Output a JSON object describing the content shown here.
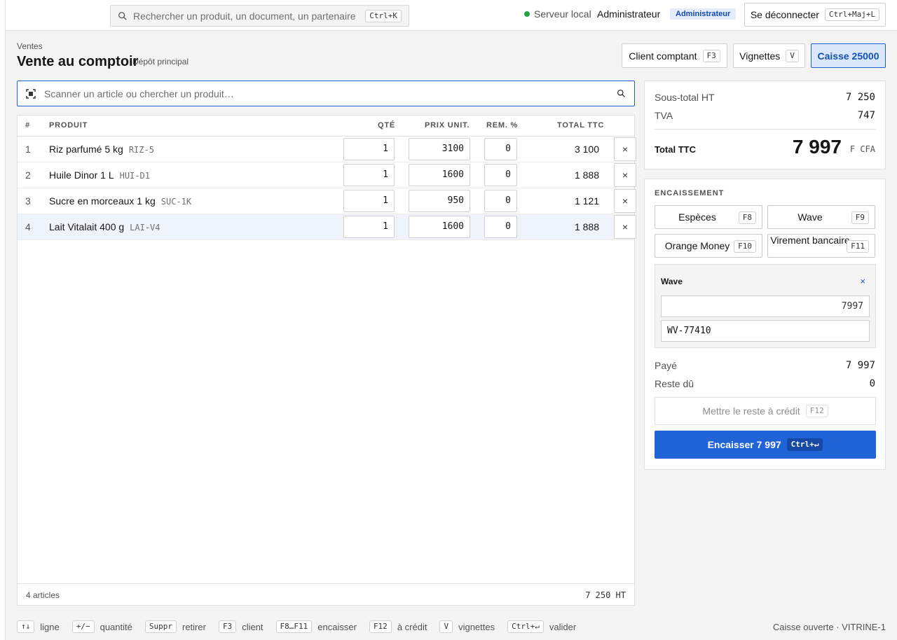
{
  "topbar": {
    "search_placeholder": "Rechercher un produit, un document, un partenaire",
    "search_shortcut": "Ctrl+K",
    "server_status": "Serveur local",
    "server_status_color": "#24a148",
    "user_name": "Administrateur",
    "role_badge": "Administrateur",
    "logout_label": "Se déconnecter",
    "logout_shortcut": "Ctrl+Maj+L"
  },
  "header": {
    "breadcrumb": "Ventes",
    "title": "Vente au comptoir",
    "depot": "Dépôt principal",
    "client_label": "Client comptant",
    "client_shortcut": "F3",
    "vignettes_label": "Vignettes",
    "vignettes_shortcut": "V",
    "caisse_label": "Caisse 25000"
  },
  "scan": {
    "placeholder": "Scanner un article ou chercher un produit…"
  },
  "table": {
    "columns": {
      "num": "#",
      "product": "PRODUIT",
      "qty": "QTÉ",
      "unit_price": "PRIX UNIT.",
      "discount": "REM. %",
      "total": "TOTAL TTC"
    },
    "rows": [
      {
        "num": "1",
        "name": "Riz parfumé 5 kg",
        "code": "RIZ-5",
        "qty": "1",
        "price": "3100",
        "discount": "0",
        "total": "3 100"
      },
      {
        "num": "2",
        "name": "Huile Dinor 1 L",
        "code": "HUI-D1",
        "qty": "1",
        "price": "1600",
        "discount": "0",
        "total": "1 888"
      },
      {
        "num": "3",
        "name": "Sucre en morceaux 1 kg",
        "code": "SUC-1K",
        "qty": "1",
        "price": "950",
        "discount": "0",
        "total": "1 121"
      },
      {
        "num": "4",
        "name": "Lait Vitalait 400 g",
        "code": "LAI-V4",
        "qty": "1",
        "price": "1600",
        "discount": "0",
        "total": "1 888"
      }
    ],
    "delete_glyph": "×",
    "footer_count": "4 articles",
    "footer_total_ht": "7 250 HT"
  },
  "summary": {
    "subtotal_label": "Sous-total HT",
    "subtotal_value": "7 250",
    "tva_label": "TVA",
    "tva_value": "747",
    "ttc_label": "Total TTC",
    "ttc_value": "7 997",
    "currency": "F CFA"
  },
  "payment": {
    "title": "ENCAISSEMENT",
    "methods": [
      {
        "label": "Espèces",
        "shortcut": "F8"
      },
      {
        "label": "Wave",
        "shortcut": "F9"
      },
      {
        "label": "Orange Money",
        "shortcut": "F10"
      },
      {
        "label": "Virement bancaire",
        "shortcut": "F11"
      }
    ],
    "active_method": "Wave",
    "remove_glyph": "×",
    "amount": "7997",
    "reference": "WV-77410",
    "paid_label": "Payé",
    "paid_value": "7 997",
    "due_label": "Reste dû",
    "due_value": "0",
    "credit_label": "Mettre le reste à crédit",
    "credit_shortcut": "F12",
    "submit_label": "Encaisser 7 997",
    "submit_shortcut": "Ctrl+↵",
    "accent_color": "#1f63d6"
  },
  "shortcuts": [
    {
      "key": "↑↓",
      "label": "ligne"
    },
    {
      "key": "+/−",
      "label": "quantité"
    },
    {
      "key": "Suppr",
      "label": "retirer"
    },
    {
      "key": "F3",
      "label": "client"
    },
    {
      "key": "F8…F11",
      "label": "encaisser"
    },
    {
      "key": "F12",
      "label": "à crédit"
    },
    {
      "key": "V",
      "label": "vignettes"
    },
    {
      "key": "Ctrl+↵",
      "label": "valider"
    }
  ],
  "status_right": "Caisse ouverte · VITRINE-1"
}
